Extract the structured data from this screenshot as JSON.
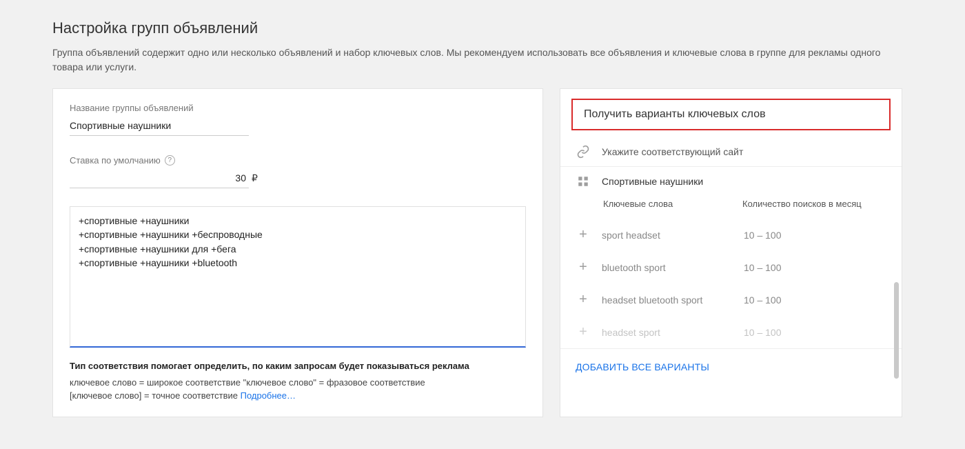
{
  "header": {
    "title": "Настройка групп объявлений",
    "subtitle": "Группа объявлений содержит одно или несколько объявлений и набор ключевых слов. Мы рекомендуем использовать все объявления и ключевые слова в группе для рекламы одного товара или услуги."
  },
  "left": {
    "group_name_label": "Название группы объявлений",
    "group_name_value": "Спортивные наушники",
    "bid_label": "Ставка по умолчанию",
    "bid_value": "30",
    "currency": "₽",
    "keywords_text": "+спортивные +наушники\n+спортивные +наушники +беспроводные\n+спортивные +наушники для +бега\n+спортивные +наушники +bluetooth",
    "match_bold": "Тип соответствия помогает определить, по каким запросам будет показываться реклама",
    "match_line1": "ключевое слово = широкое соответствие   \"ключевое слово\" = фразовое соответствие",
    "match_line2_prefix": "[ключевое слово] = точное соответствие   ",
    "learn_more": "Подробнее…"
  },
  "right": {
    "heading": "Получить варианты ключевых слов",
    "site_hint": "Укажите соответствующий сайт",
    "product_name": "Спортивные наушники",
    "col_keywords": "Ключевые слова",
    "col_count": "Количество поисков в месяц",
    "suggestions": [
      {
        "name": "sport headset",
        "count": "10 – 100"
      },
      {
        "name": "bluetooth sport",
        "count": "10 – 100"
      },
      {
        "name": "headset bluetooth sport",
        "count": "10 – 100"
      },
      {
        "name": "headset sport",
        "count": "10 – 100"
      }
    ],
    "add_all": "ДОБАВИТЬ ВСЕ ВАРИАНТЫ"
  }
}
